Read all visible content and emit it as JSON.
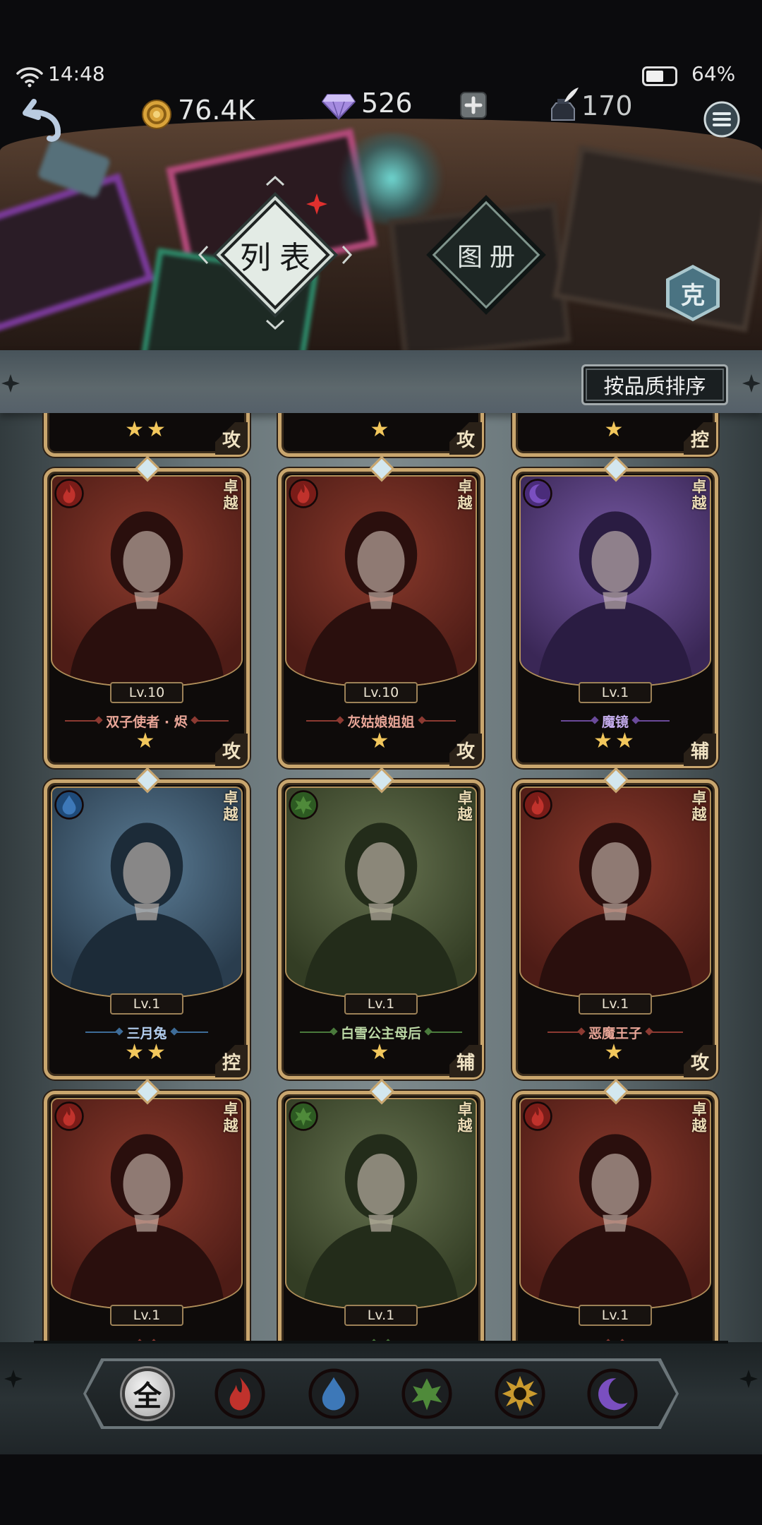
{
  "status_bar": {
    "time": "14:48",
    "battery": "64%",
    "battery_level": 0.64
  },
  "currencies": {
    "gold": "76.4K",
    "diamonds": "526",
    "ink": "170"
  },
  "header_icons": [
    "back-arrow-icon",
    "gold-coin-icon",
    "diamond-icon",
    "plus-icon",
    "ink-pot-icon",
    "menu-icon"
  ],
  "tabs": [
    {
      "label": "列表",
      "active": true
    },
    {
      "label": "图册",
      "active": false
    }
  ],
  "counter_badge": "克",
  "sort_button": "按品质排序",
  "colors": {
    "card_frame": "#c9a66e",
    "star": "#f2c75c",
    "new_indicator": "#e0302e",
    "panel": "#7e8a8d"
  },
  "element_colors": {
    "fire": "#c0322c",
    "water": "#3d78b8",
    "wood": "#4f8a3a",
    "light": "#c99a2e",
    "dark": "#7a4fc0"
  },
  "cards": [
    {
      "name": "",
      "level": "",
      "stars": 2,
      "role": "攻",
      "element": "water",
      "quality": ""
    },
    {
      "name": "",
      "level": "",
      "stars": 1,
      "role": "攻",
      "element": "fire",
      "quality": ""
    },
    {
      "name": "",
      "level": "",
      "stars": 1,
      "role": "控",
      "element": "dark",
      "quality": ""
    },
    {
      "name": "双子使者 · 烬",
      "level": "Lv.10",
      "stars": 1,
      "role": "攻",
      "element": "fire",
      "quality": "卓越"
    },
    {
      "name": "灰姑娘姐姐",
      "level": "Lv.10",
      "stars": 1,
      "role": "攻",
      "element": "fire",
      "quality": "卓越"
    },
    {
      "name": "魔镜",
      "level": "Lv.1",
      "stars": 2,
      "role": "辅",
      "element": "dark",
      "quality": "卓越"
    },
    {
      "name": "三月兔",
      "level": "Lv.1",
      "stars": 2,
      "role": "控",
      "element": "water",
      "quality": "卓越"
    },
    {
      "name": "白雪公主母后",
      "level": "Lv.1",
      "stars": 1,
      "role": "辅",
      "element": "wood",
      "quality": "卓越"
    },
    {
      "name": "恶魔王子",
      "level": "Lv.1",
      "stars": 1,
      "role": "攻",
      "element": "fire",
      "quality": "卓越"
    },
    {
      "name": "",
      "level": "Lv.1",
      "stars": 0,
      "role": "",
      "element": "fire",
      "quality": "卓越"
    },
    {
      "name": "",
      "level": "Lv.1",
      "stars": 0,
      "role": "",
      "element": "wood",
      "quality": "卓越"
    },
    {
      "name": "",
      "level": "Lv.1",
      "stars": 0,
      "role": "",
      "element": "fire",
      "quality": "卓越"
    }
  ],
  "filters": [
    {
      "label": "全",
      "element": "all",
      "selected": true
    },
    {
      "label": "",
      "element": "fire",
      "selected": false
    },
    {
      "label": "",
      "element": "water",
      "selected": false
    },
    {
      "label": "",
      "element": "wood",
      "selected": false
    },
    {
      "label": "",
      "element": "light",
      "selected": false
    },
    {
      "label": "",
      "element": "dark",
      "selected": false
    }
  ]
}
